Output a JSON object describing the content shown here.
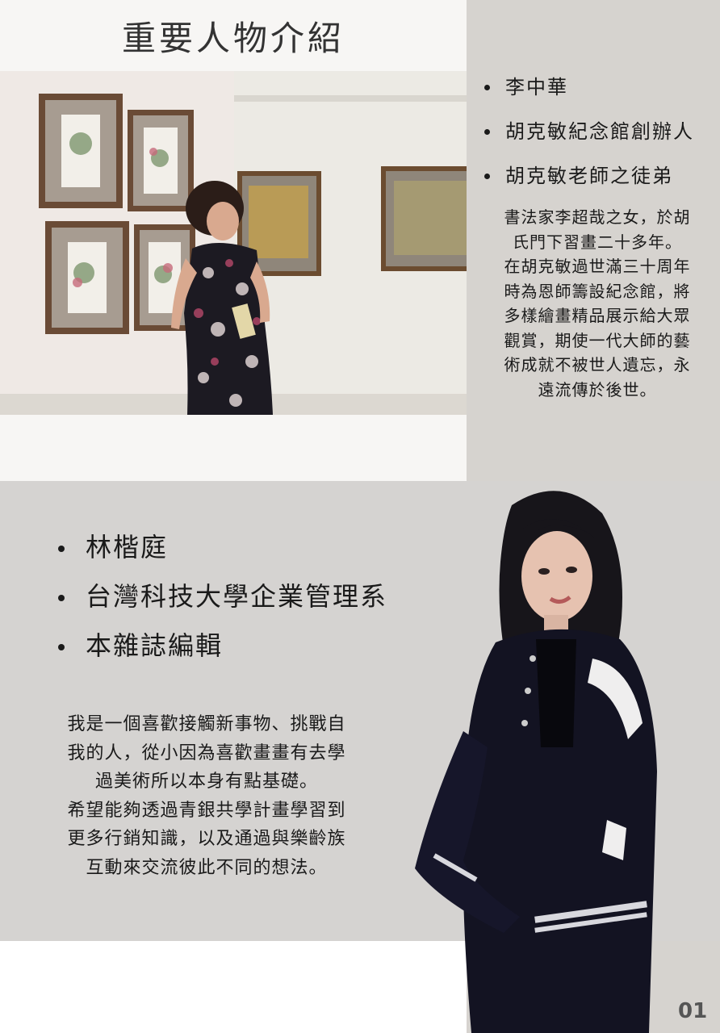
{
  "page": {
    "title": "重要人物介紹",
    "page_number": "01"
  },
  "person1": {
    "bullets": [
      "李中華",
      "胡克敏紀念館創辦人",
      "胡克敏老師之徒弟"
    ],
    "description_lines": [
      "書法家李超哉之女，於胡",
      "氏門下習畫二十多年。",
      "在胡克敏過世滿三十周年",
      "時為恩師籌設紀念館，將",
      "多樣繪畫精品展示給大眾",
      "觀賞，期使一代大師的藝",
      "術成就不被世人遺忘，永",
      "遠流傳於後世。"
    ]
  },
  "person2": {
    "bullets": [
      "林楷庭",
      "台灣科技大學企業管理系",
      "本雜誌編輯"
    ],
    "description_lines": [
      "我是一個喜歡接觸新事物、挑戰自",
      "我的人，從小因為喜歡畫畫有去學",
      "過美術所以本身有點基礎。",
      "希望能夠透過青銀共學計畫學習到",
      "更多行銷知識，以及通過與樂齡族",
      "互動來交流彼此不同的想法。"
    ]
  }
}
